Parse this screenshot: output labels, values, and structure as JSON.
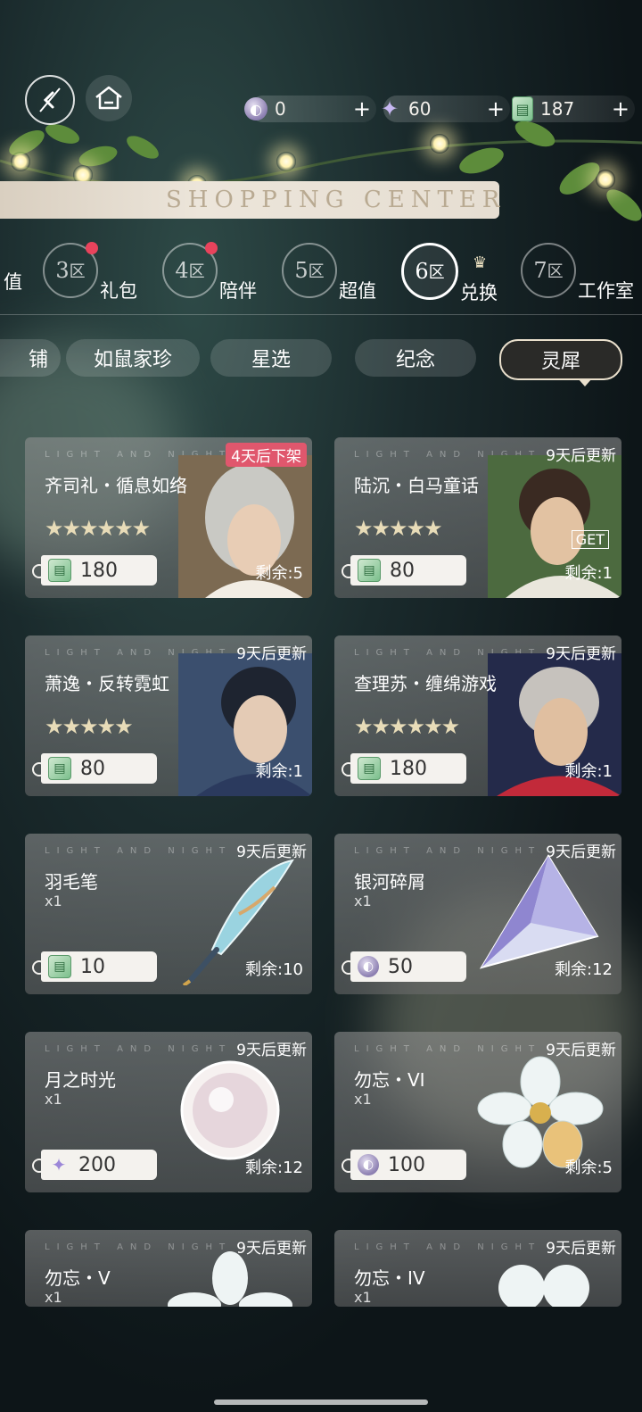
{
  "colors": {
    "accent_red": "#e0576d",
    "notification_dot": "#e8435c",
    "active_tab_bg": "#2a2a28"
  },
  "topbar": {
    "back_icon": "back-arrow-icon",
    "home_icon": "home-icon",
    "currencies": [
      {
        "icon": "moon-coin-icon",
        "value": "0",
        "plus": "+"
      },
      {
        "icon": "sparkle-icon",
        "value": "60",
        "plus": "+"
      },
      {
        "icon": "ticket-icon",
        "value": "187",
        "plus": "+"
      }
    ]
  },
  "banner": {
    "title": "SHOPPING CENTER"
  },
  "zones": [
    {
      "prefix": "",
      "num": "",
      "label": "值",
      "dot": false,
      "active": false
    },
    {
      "num": "3",
      "unit": "区",
      "label": "礼包",
      "dot": true,
      "active": false
    },
    {
      "num": "4",
      "unit": "区",
      "label": "陪伴",
      "dot": true,
      "active": false
    },
    {
      "num": "5",
      "unit": "区",
      "label": "超值",
      "dot": false,
      "active": false
    },
    {
      "num": "6",
      "unit": "区",
      "label": "兑换",
      "dot": false,
      "active": true
    },
    {
      "num": "7",
      "unit": "区",
      "label": "工作室",
      "dot": false,
      "active": false
    }
  ],
  "subtabs": [
    "铺",
    "如鼠家珍",
    "星选",
    "纪念",
    "灵犀"
  ],
  "watermark": "LIGHT AND NIGHT",
  "cards": [
    {
      "title": "齐司礼・循息如络",
      "stars": "★★★★★★",
      "timer": "4天后下架",
      "price": "180",
      "currency": "ticket",
      "remain": "剩余:5"
    },
    {
      "title": "陆沉・白马童话",
      "stars": "★★★★★",
      "timer": "9天后更新",
      "price": "80",
      "currency": "ticket",
      "remain": "剩余:1",
      "badge": "GET"
    },
    {
      "title": "萧逸・反转霓虹",
      "stars": "★★★★★",
      "timer": "9天后更新",
      "price": "80",
      "currency": "ticket",
      "remain": "剩余:1"
    },
    {
      "title": "查理苏・缠绵游戏",
      "stars": "★★★★★★",
      "timer": "9天后更新",
      "price": "180",
      "currency": "ticket",
      "remain": "剩余:1"
    },
    {
      "title": "羽毛笔",
      "qty": "x1",
      "timer": "9天后更新",
      "price": "10",
      "currency": "ticket",
      "remain": "剩余:10"
    },
    {
      "title": "银河碎屑",
      "qty": "x1",
      "timer": "9天后更新",
      "price": "50",
      "currency": "moon",
      "remain": "剩余:12"
    },
    {
      "title": "月之时光",
      "qty": "x1",
      "timer": "9天后更新",
      "price": "200",
      "currency": "sparkle",
      "remain": "剩余:12"
    },
    {
      "title": "勿忘・VI",
      "qty": "x1",
      "timer": "9天后更新",
      "price": "100",
      "currency": "moon",
      "remain": "剩余:5"
    },
    {
      "title": "勿忘・V",
      "qty": "x1",
      "timer": "9天后更新"
    },
    {
      "title": "勿忘・IV",
      "qty": "x1",
      "timer": "9天后更新"
    }
  ]
}
